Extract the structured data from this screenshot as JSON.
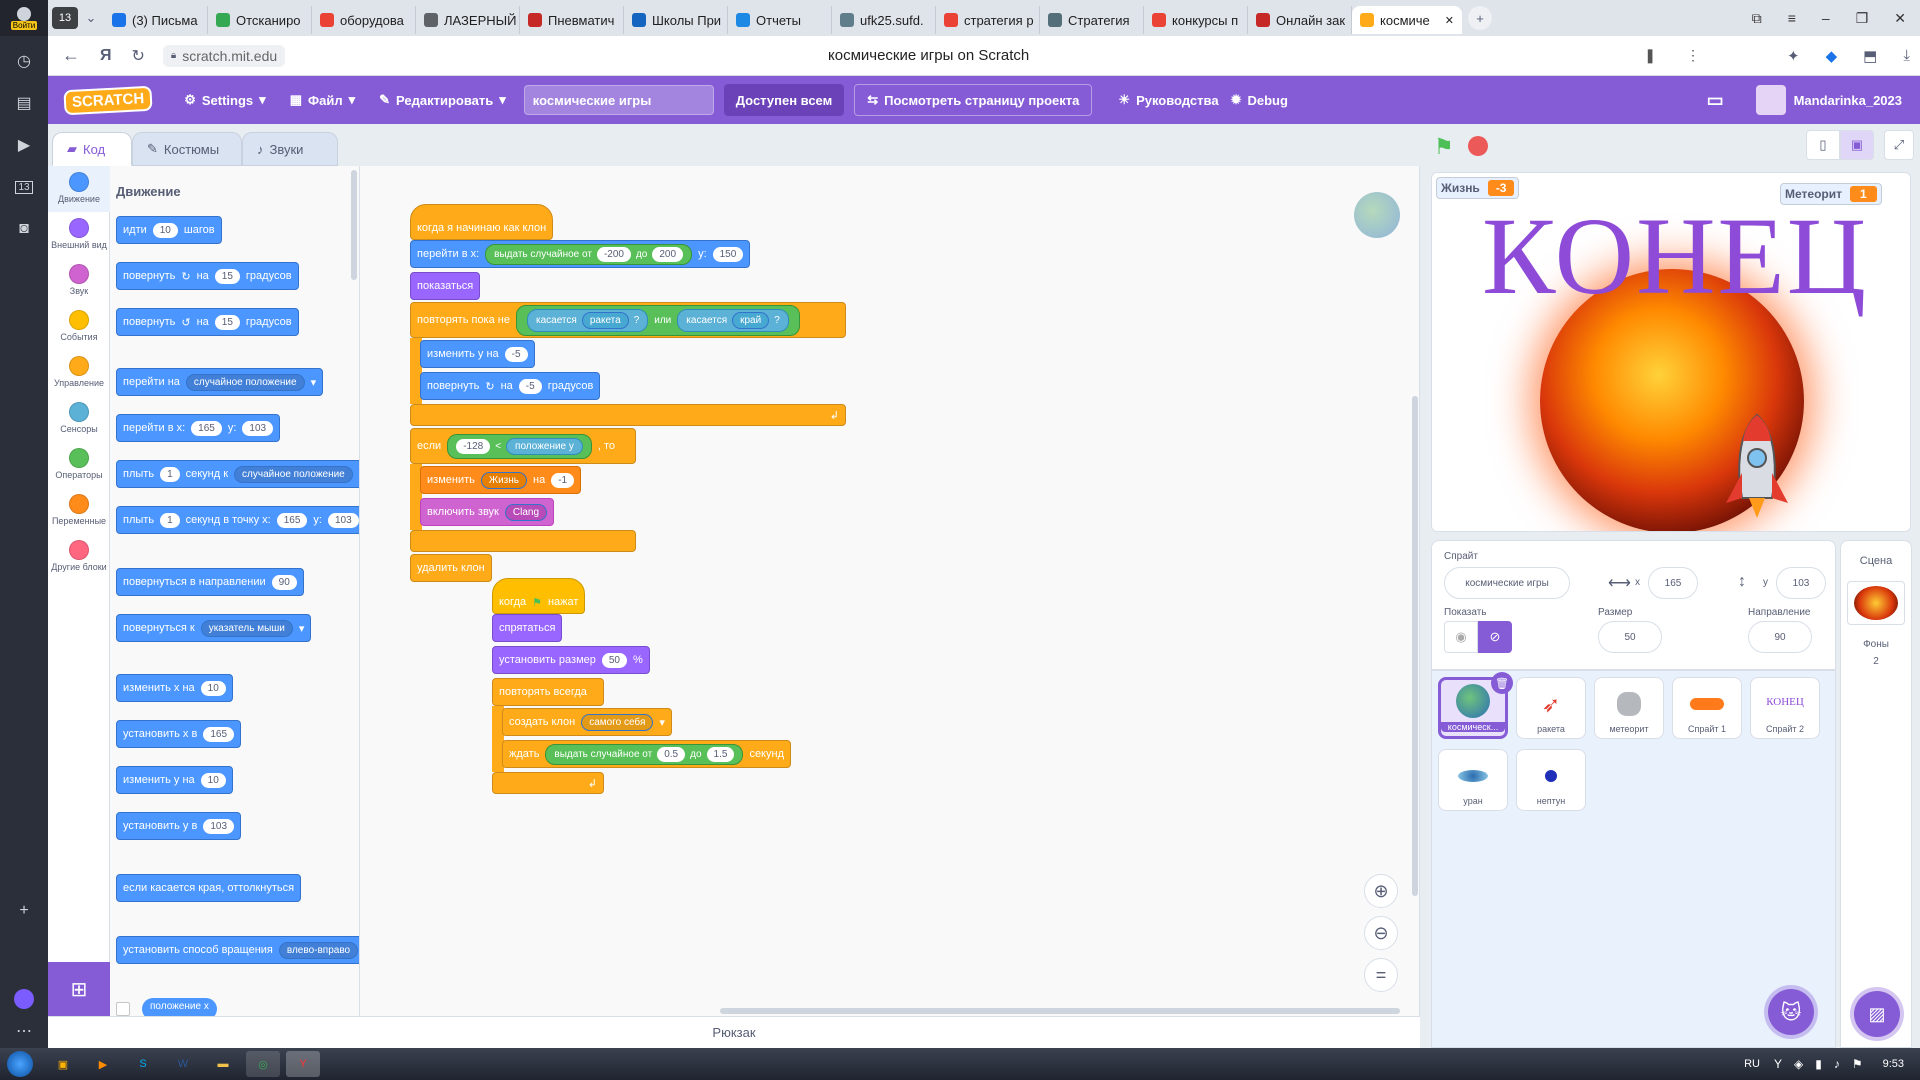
{
  "browser": {
    "tab_count": "13",
    "tabs": [
      {
        "label": "(3) Письма",
        "color": "#1a73e8"
      },
      {
        "label": "Отсканиро",
        "color": "#34a853"
      },
      {
        "label": "оборудова",
        "color": "#ea4335"
      },
      {
        "label": "ЛАЗЕРНЫЙ",
        "color": "#5f6368"
      },
      {
        "label": "Пневматич",
        "color": "#c62828"
      },
      {
        "label": "Школы При",
        "color": "#1565c0"
      },
      {
        "label": "Отчеты",
        "color": "#1e88e5"
      },
      {
        "label": "ufk25.sufd.",
        "color": "#607d8b"
      },
      {
        "label": "стратегия р",
        "color": "#ea4335"
      },
      {
        "label": "Стратегия",
        "color": "#546e7a"
      },
      {
        "label": "конкурсы п",
        "color": "#ea4335"
      },
      {
        "label": "Онлайн зак",
        "color": "#c62828"
      },
      {
        "label": "космиче",
        "color": "#ffab19"
      }
    ],
    "login_label": "Войти",
    "url": "scratch.mit.edu",
    "page_title": "космические игры on Scratch"
  },
  "menubar": {
    "logo": "SCRATCH",
    "settings": "Settings",
    "file": "Файл",
    "edit": "Редактировать",
    "project_title": "космические игры",
    "share": "Доступен всем",
    "see_project": "Посмотреть страницу проекта",
    "tutorials": "Руководства",
    "debug": "Debug",
    "username": "Mandarinka_2023"
  },
  "editor_tabs": {
    "code": "Код",
    "costumes": "Костюмы",
    "sounds": "Звуки"
  },
  "categories": [
    {
      "label": "Движение",
      "color": "#4c97ff"
    },
    {
      "label": "Внешний вид",
      "color": "#9966ff"
    },
    {
      "label": "Звук",
      "color": "#cf63cf"
    },
    {
      "label": "События",
      "color": "#ffbf00"
    },
    {
      "label": "Управление",
      "color": "#ffab19"
    },
    {
      "label": "Сенсоры",
      "color": "#5cb1d6"
    },
    {
      "label": "Операторы",
      "color": "#59c059"
    },
    {
      "label": "Переменные",
      "color": "#ff8c1a"
    },
    {
      "label": "Другие блоки",
      "color": "#ff6680"
    }
  ],
  "palette": {
    "heading": "Движение",
    "move": {
      "a": "идти",
      "v": "10",
      "b": "шагов"
    },
    "turn_right": {
      "a": "повернуть",
      "b": "на",
      "v": "15",
      "c": "градусов"
    },
    "turn_left": {
      "a": "повернуть",
      "b": "на",
      "v": "15",
      "c": "градусов"
    },
    "goto": {
      "a": "перейти на",
      "dd": "случайное положение"
    },
    "goto_xy": {
      "a": "перейти в x:",
      "x": "165",
      "b": "y:",
      "y": "103"
    },
    "glide": {
      "a": "плыть",
      "v": "1",
      "b": "секунд к",
      "dd": "случайное положение"
    },
    "glide_xy": {
      "a": "плыть",
      "v": "1",
      "b": "секунд в точку x:",
      "x": "165",
      "c": "y:",
      "y": "103"
    },
    "point_dir": {
      "a": "повернуться в направлении",
      "v": "90"
    },
    "point_towards": {
      "a": "повернуться к",
      "dd": "указатель мыши"
    },
    "change_x": {
      "a": "изменить x на",
      "v": "10"
    },
    "set_x": {
      "a": "установить x в",
      "v": "165"
    },
    "change_y": {
      "a": "изменить y на",
      "v": "10"
    },
    "set_y": {
      "a": "установить y в",
      "v": "103"
    },
    "bounce": "если касается края, оттолкнуться",
    "rotation": {
      "a": "установить способ вращения",
      "dd": "влево-вправо"
    },
    "xpos": "положение x"
  },
  "script1": {
    "hat": "когда я начинаю как клон",
    "goto": {
      "a": "перейти в x:",
      "rand": "выдать случайное от",
      "from": "-200",
      "to_l": "до",
      "to": "200",
      "y_l": "y:",
      "y": "150"
    },
    "show": "показаться",
    "repeat_until": {
      "a": "повторять пока не",
      "touch1": "касается",
      "dd1": "ракета",
      "q": "?",
      "or": "или",
      "touch2": "касается",
      "dd2": "край"
    },
    "change_y": {
      "a": "изменить y на",
      "v": "-5"
    },
    "turn": {
      "a": "повернуть",
      "b": "на",
      "v": "-5",
      "c": "градусов"
    },
    "if": {
      "a": "если",
      "v": "-128",
      "lt": "<",
      "pos": "положение y",
      "then": ", то"
    },
    "change_var": {
      "a": "изменить",
      "dd": "Жизнь",
      "b": "на",
      "v": "-1"
    },
    "sound": {
      "a": "включить звук",
      "dd": "Clang"
    },
    "delete": "удалить клон"
  },
  "script2": {
    "hat_a": "когда",
    "hat_b": "нажат",
    "hide": "спрятаться",
    "size": {
      "a": "установить размер",
      "v": "50",
      "b": "%"
    },
    "forever": "повторять всегда",
    "clone": {
      "a": "создать клон",
      "dd": "самого себя"
    },
    "wait": {
      "a": "ждать",
      "rand": "выдать случайное от",
      "from": "0.5",
      "to_l": "до",
      "to": "1.5",
      "b": "секунд"
    }
  },
  "stage": {
    "var1_name": "Жизнь",
    "var1_value": "-3",
    "var2_name": "Метеорит",
    "var2_value": "1",
    "big_text": "КОНЕЦ"
  },
  "sprite_info": {
    "sprite_label": "Спрайт",
    "sprite_name": "космические игры",
    "x_label": "x",
    "x": "165",
    "y_label": "y",
    "y": "103",
    "show_label": "Показать",
    "size_label": "Размер",
    "size": "50",
    "dir_label": "Направление",
    "dir": "90"
  },
  "sprites": [
    "космическ...",
    "ракета",
    "метеорит",
    "Спрайт 1",
    "Спрайт 2",
    "уран",
    "нептун"
  ],
  "sprite2_thumb_text": "КОНЕЦ",
  "stage_selector": {
    "label": "Сцена",
    "backdrops_label": "Фоны",
    "backdrops": "2"
  },
  "backpack": "Рюкзак",
  "taskbar": {
    "lang": "RU",
    "time": "9:53"
  }
}
